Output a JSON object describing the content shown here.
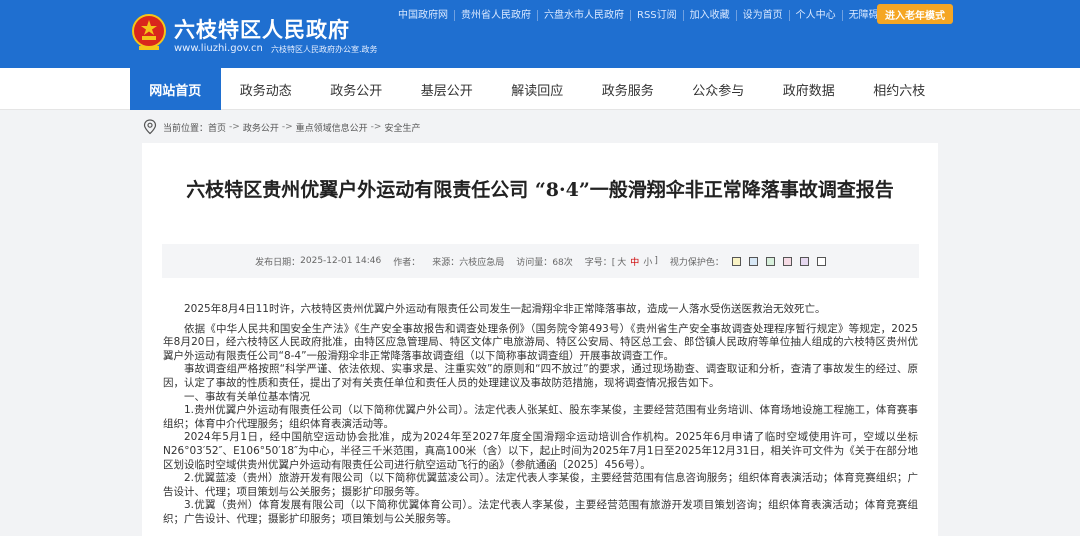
{
  "header": {
    "title": "六枝特区人民政府",
    "url": "www.liuzhi.gov.cn",
    "subtitle": "六枝特区人民政府办公室.政务",
    "top_links": [
      "中国政府网",
      "贵州省人民政府",
      "六盘水市人民政府",
      "RSS订阅",
      "加入收藏",
      "设为首页",
      "个人中心",
      "无障碍浏览"
    ],
    "elder_mode": "进入老年模式",
    "colors": {
      "primary": "#1f6fd0",
      "accent": "#f5a623"
    }
  },
  "nav": [
    "网站首页",
    "政务动态",
    "政务公开",
    "基层公开",
    "解读回应",
    "政务服务",
    "公众参与",
    "政府数据",
    "相约六枝"
  ],
  "breadcrumb": {
    "label": "当前位置：",
    "items": [
      "首页",
      "政务公开",
      "重点领域信息公开",
      "安全生产"
    ],
    "sep": "->"
  },
  "article": {
    "title": "六枝特区贵州优翼户外运动有限责任公司 “8·4”一般滑翔伞非正常降落事故调查报告",
    "meta": {
      "date_label": "发布日期：",
      "date": "2025-12-01 14:46",
      "author_label": "作者：",
      "source_label": "来源：",
      "source": "六枝应急局",
      "visits_label": "访问量：",
      "visits": "68次",
      "font_label": "字号：[",
      "font_large": "大",
      "font_mid": "中",
      "font_small": "小",
      "font_end": "]",
      "eye_label": "视力保护色：",
      "eye_colors": [
        "#f9f3c5",
        "#d8e8f6",
        "#d8f0dc",
        "#f6dbe5",
        "#e6d8f0",
        "#ffffff"
      ]
    },
    "paragraphs": [
      "2025年8月4日11时许，六枝特区贵州优翼户外运动有限责任公司发生一起滑翔伞非正常降落事故，造成一人落水受伤送医救治无效死亡。",
      "依据《中华人民共和国安全生产法》《生产安全事故报告和调查处理条例》（国务院令第493号）《贵州省生产安全事故调查处理程序暂行规定》等规定，2025年8月20日，经六枝特区人民政府批准，由特区应急管理局、特区文体广电旅游局、特区公安局、特区总工会、郎岱镇人民政府等单位抽人组成的六枝特区贵州优翼户外运动有限责任公司“8-4”一般滑翔伞非正常降落事故调查组（以下简称事故调查组）开展事故调查工作。",
      "事故调查组严格按照“科学严谨、依法依规、实事求是、注重实效”的原则和“四不放过”的要求，通过现场勘查、调查取证和分析，查清了事故发生的经过、原因，认定了事故的性质和责任，提出了对有关责任单位和责任人员的处理建议及事故防范措施，现将调查情况报告如下。",
      "一、事故有关单位基本情况",
      "1.贵州优翼户外运动有限责任公司（以下简称优翼户外公司）。法定代表人张某虹、股东李某俊，主要经营范围有业务培训、体育场地设施工程施工，体育赛事组织；体育中介代理服务；组织体育表演活动等。",
      "2024年5月1日，经中国航空运动协会批准，成为2024年至2027年度全国滑翔伞运动培训合作机构。2025年6月申请了临时空域使用许可，空域以坐标N26°03′52″、E106°50′18″为中心，半径三千米范围，真高100米（含）以下，起止时间为2025年7月1日至2025年12月31日，相关许可文件为《关于在部分地区划设临时空域供贵州优翼户外运动有限责任公司进行航空运动飞行的函》（参航通函〔2025〕456号）。",
      "2.优翼蓝凌（贵州）旅游开发有限公司（以下简称优翼蓝凌公司）。法定代表人李某俊，主要经营范围有信息咨询服务；组织体育表演活动；体育竞赛组织；广告设计、代理；项目策划与公关服务；摄影扩印服务等。",
      "3.优翼（贵州）体育发展有限公司（以下简称优翼体育公司）。法定代表人李某俊，主要经营范围有旅游开发项目策划咨询；组织体育表演活动；体育竞赛组织；广告设计、代理；摄影扩印服务；项目策划与公关服务等。"
    ]
  }
}
